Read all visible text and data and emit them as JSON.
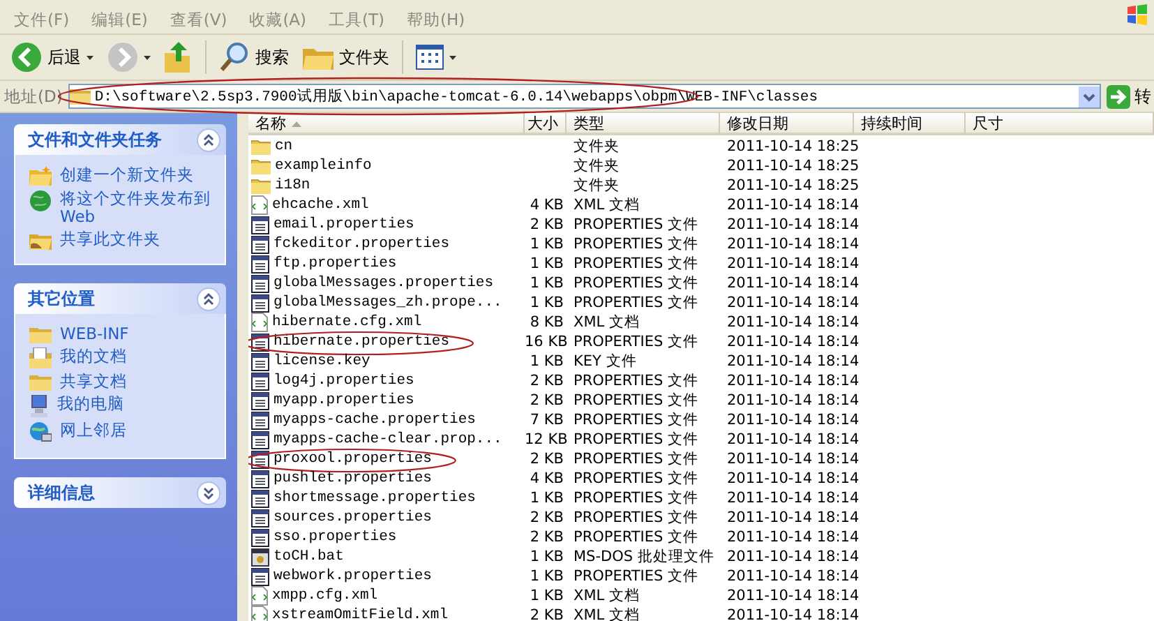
{
  "menu": [
    {
      "label": "文件(F)"
    },
    {
      "label": "编辑(E)"
    },
    {
      "label": "查看(V)"
    },
    {
      "label": "收藏(A)"
    },
    {
      "label": "工具(T)"
    },
    {
      "label": "帮助(H)"
    }
  ],
  "toolbar": [
    {
      "kind": "back",
      "label": "后退"
    },
    {
      "kind": "forward"
    },
    {
      "kind": "up"
    },
    {
      "kind": "search",
      "label": "搜索"
    },
    {
      "kind": "folders",
      "label": "文件夹"
    },
    {
      "kind": "views"
    }
  ],
  "address": {
    "label": "地址(D)",
    "value": "D:\\software\\2.5sp3.7900试用版\\bin\\apache-tomcat-6.0.14\\webapps\\obpm\\WEB-INF\\classes",
    "circled": true,
    "go_label": "转"
  },
  "task_panes": [
    {
      "title": "文件和文件夹任务",
      "expanded": true,
      "items": [
        {
          "kind": "new-folder",
          "label": "创建一个新文件夹"
        },
        {
          "kind": "globe",
          "label": "将这个文件夹发布到 Web"
        },
        {
          "kind": "share",
          "label": "共享此文件夹"
        }
      ]
    },
    {
      "title": "其它位置",
      "expanded": true,
      "items": [
        {
          "kind": "folder",
          "label": "WEB-INF"
        },
        {
          "kind": "document",
          "label": "我的文档"
        },
        {
          "kind": "folder",
          "label": "共享文档"
        },
        {
          "kind": "computer",
          "label": "我的电脑"
        },
        {
          "kind": "network",
          "label": "网上邻居"
        }
      ]
    },
    {
      "title": "详细信息",
      "expanded": false
    }
  ],
  "columns": [
    {
      "label": "名称",
      "sorted": true
    },
    {
      "label": "大小",
      "sorted": false
    },
    {
      "label": "类型",
      "sorted": false
    },
    {
      "label": "修改日期",
      "sorted": false
    },
    {
      "label": "持续时间",
      "sorted": false
    },
    {
      "label": "尺寸",
      "sorted": false
    }
  ],
  "files": [
    {
      "kind": "folder",
      "name": "cn",
      "type": "文件夹",
      "modified": "2011-10-14 18:25",
      "circled": false
    },
    {
      "kind": "folder",
      "name": "exampleinfo",
      "type": "文件夹",
      "modified": "2011-10-14 18:25",
      "circled": false
    },
    {
      "kind": "folder",
      "name": "i18n",
      "type": "文件夹",
      "modified": "2011-10-14 18:25",
      "circled": false
    },
    {
      "kind": "xml",
      "name": "ehcache.xml",
      "size": "4 KB",
      "type": "XML 文档",
      "modified": "2011-10-14 18:14",
      "circled": false
    },
    {
      "kind": "properties",
      "name": "email.properties",
      "size": "2 KB",
      "type": "PROPERTIES 文件",
      "modified": "2011-10-14 18:14",
      "circled": false
    },
    {
      "kind": "properties",
      "name": "fckeditor.properties",
      "size": "1 KB",
      "type": "PROPERTIES 文件",
      "modified": "2011-10-14 18:14",
      "circled": false
    },
    {
      "kind": "properties",
      "name": "ftp.properties",
      "size": "1 KB",
      "type": "PROPERTIES 文件",
      "modified": "2011-10-14 18:14",
      "circled": false
    },
    {
      "kind": "properties",
      "name": "globalMessages.properties",
      "size": "1 KB",
      "type": "PROPERTIES 文件",
      "modified": "2011-10-14 18:14",
      "circled": false
    },
    {
      "kind": "properties",
      "name": "globalMessages_zh.prope...",
      "size": "1 KB",
      "type": "PROPERTIES 文件",
      "modified": "2011-10-14 18:14",
      "circled": false
    },
    {
      "kind": "xml",
      "name": "hibernate.cfg.xml",
      "size": "8 KB",
      "type": "XML 文档",
      "modified": "2011-10-14 18:14",
      "circled": false
    },
    {
      "kind": "properties",
      "name": "hibernate.properties",
      "size": "16 KB",
      "type": "PROPERTIES 文件",
      "modified": "2011-10-14 18:14",
      "circled": true
    },
    {
      "kind": "properties",
      "name": "license.key",
      "size": "1 KB",
      "type": "KEY 文件",
      "modified": "2011-10-14 18:14",
      "circled": false
    },
    {
      "kind": "properties",
      "name": "log4j.properties",
      "size": "2 KB",
      "type": "PROPERTIES 文件",
      "modified": "2011-10-14 18:14",
      "circled": false
    },
    {
      "kind": "properties",
      "name": "myapp.properties",
      "size": "2 KB",
      "type": "PROPERTIES 文件",
      "modified": "2011-10-14 18:14",
      "circled": false
    },
    {
      "kind": "properties",
      "name": "myapps-cache.properties",
      "size": "7 KB",
      "type": "PROPERTIES 文件",
      "modified": "2011-10-14 18:14",
      "circled": false
    },
    {
      "kind": "properties",
      "name": "myapps-cache-clear.prop...",
      "size": "12 KB",
      "type": "PROPERTIES 文件",
      "modified": "2011-10-14 18:14",
      "circled": false
    },
    {
      "kind": "properties",
      "name": "proxool.properties",
      "size": "2 KB",
      "type": "PROPERTIES 文件",
      "modified": "2011-10-14 18:14",
      "circled": true
    },
    {
      "kind": "properties",
      "name": "pushlet.properties",
      "size": "4 KB",
      "type": "PROPERTIES 文件",
      "modified": "2011-10-14 18:14",
      "circled": false
    },
    {
      "kind": "properties",
      "name": "shortmessage.properties",
      "size": "1 KB",
      "type": "PROPERTIES 文件",
      "modified": "2011-10-14 18:14",
      "circled": false
    },
    {
      "kind": "properties",
      "name": "sources.properties",
      "size": "2 KB",
      "type": "PROPERTIES 文件",
      "modified": "2011-10-14 18:14",
      "circled": false
    },
    {
      "kind": "properties",
      "name": "sso.properties",
      "size": "2 KB",
      "type": "PROPERTIES 文件",
      "modified": "2011-10-14 18:14",
      "circled": false
    },
    {
      "kind": "bat",
      "name": "toCH.bat",
      "size": "1 KB",
      "type": "MS-DOS 批处理文件",
      "modified": "2011-10-14 18:14",
      "circled": false
    },
    {
      "kind": "properties",
      "name": "webwork.properties",
      "size": "1 KB",
      "type": "PROPERTIES 文件",
      "modified": "2011-10-14 18:14",
      "circled": false
    },
    {
      "kind": "xml",
      "name": "xmpp.cfg.xml",
      "size": "1 KB",
      "type": "XML 文档",
      "modified": "2011-10-14 18:14",
      "circled": false
    },
    {
      "kind": "xml",
      "name": "xstreamOmitField.xml",
      "size": "2 KB",
      "type": "XML 文档",
      "modified": "2011-10-14 18:14",
      "circled": false
    }
  ]
}
